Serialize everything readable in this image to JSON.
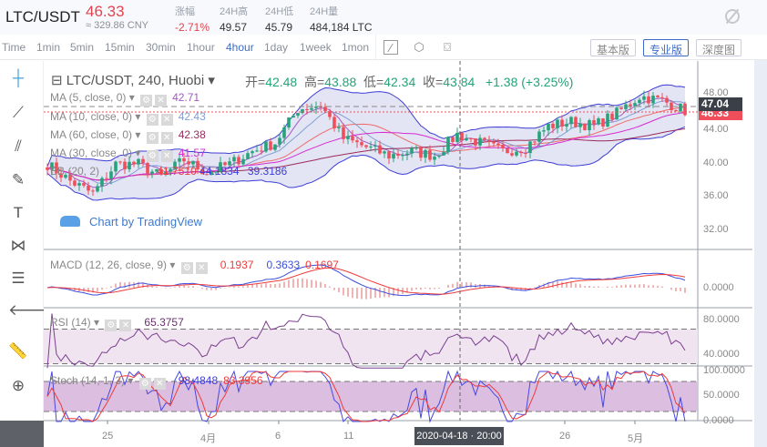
{
  "header": {
    "pair": "LTC/USDT",
    "last": "46.33",
    "cny": "≈ 329.86 CNY",
    "stats": [
      {
        "label": "涨幅",
        "value": "-2.71%",
        "neg": true
      },
      {
        "label": "24H高",
        "value": "49.57"
      },
      {
        "label": "24H低",
        "value": "45.79"
      },
      {
        "label": "24H量",
        "value": "484,184 LTC"
      }
    ]
  },
  "toolbar": {
    "intervals": [
      "Time",
      "1min",
      "5min",
      "15min",
      "30min",
      "1hour",
      "4hour",
      "1day",
      "1week",
      "1mon"
    ],
    "active": "4hour",
    "modes": [
      "基本版",
      "专业版",
      "深度图"
    ],
    "active_mode": "专业版"
  },
  "chart": {
    "title": "LTC/USDT, 240, Huobi",
    "ohlc": {
      "open_label": "开=",
      "open": "42.48",
      "high_label": "高=",
      "high": "43.88",
      "low_label": "低=",
      "low": "42.34",
      "close_label": "收=",
      "close": "43.84",
      "change": "+1.38 (+3.25%)"
    },
    "studies": [
      {
        "label": "MA (5, close, 0)",
        "value": "42.71",
        "color": "#a25bc4"
      },
      {
        "label": "MA (10, close, 0)",
        "value": "42.43",
        "color": "#7f9fd3"
      },
      {
        "label": "MA (60, close, 0)",
        "value": "42.38",
        "color": "#9b2b5c"
      },
      {
        "label": "MA (30, close, 0)",
        "value": "41.57",
        "color": "#d52cd2"
      },
      {
        "label": "BB (20, 2)",
        "values": [
          "41.7510",
          "44.1834",
          "39.3186"
        ]
      }
    ],
    "watermark": "Chart by TradingView",
    "price_ticks": [
      "48.00",
      "44.00",
      "40.00",
      "36.00",
      "32.00"
    ],
    "last_price_label": "47.04",
    "current_price_label": "46.33",
    "macd": {
      "label": "MACD (12, 26, close, 9)",
      "values": [
        "0.1937",
        "0.3633",
        "0.1697"
      ],
      "ticks": [
        "0.0000"
      ]
    },
    "rsi": {
      "label": "RSI (14)",
      "value": "65.3757",
      "ticks": [
        "80.0000",
        "40.0000"
      ]
    },
    "stoch": {
      "label": "Stoch (14, 1, 3)",
      "values": [
        "98.4848",
        "83.3956"
      ],
      "ticks": [
        "100.0000",
        "50.0000",
        "0.0000"
      ]
    },
    "x_ticks": [
      "25",
      "4月",
      "6",
      "11",
      "26",
      "5月"
    ],
    "crosshair_date": "2020-04-18 · 20:00",
    "colors": {
      "up": "#26a37a",
      "down": "#ef4f5a",
      "bb": "#3d3dd6",
      "macd": "#3b4fe0",
      "signal": "#ef3b3b",
      "rsi": "#7b3f8f"
    }
  },
  "chart_data": {
    "type": "candlestick",
    "close_approx": [
      40,
      38,
      36.5,
      40,
      40,
      38.5,
      40.5,
      39,
      40,
      41.5,
      42.5,
      46.5,
      47,
      43,
      42,
      41,
      41.5,
      41,
      43.5,
      42.5,
      41.5,
      42,
      44.5,
      45,
      44.5,
      46,
      48,
      47.5,
      46.3
    ],
    "ylim": [
      30,
      50
    ]
  }
}
